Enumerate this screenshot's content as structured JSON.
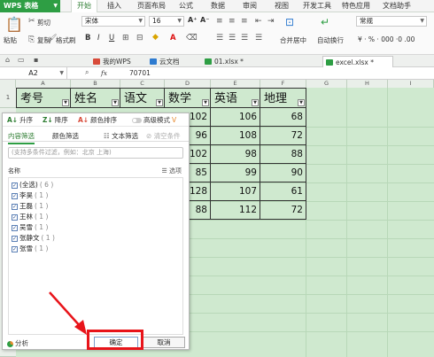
{
  "ribbon_tabs": {
    "app": "WPS 表格",
    "items": [
      "开始",
      "插入",
      "页面布局",
      "公式",
      "数据",
      "审阅",
      "视图",
      "开发工具",
      "特色应用",
      "文档助手"
    ],
    "active": "开始"
  },
  "ribbon": {
    "cut": "剪切",
    "paste": "粘贴",
    "copy": "复制",
    "format_painter": "格式刷",
    "font_name": "宋体",
    "font_size": "16",
    "merge_center": "合并居中",
    "wrap_text": "自动换行",
    "number_format": "常规",
    "number_buttons": "¥ · % · 000 ·0 .00"
  },
  "doc_tabs": [
    {
      "label": "我的WPS",
      "color": "#d84b3a"
    },
    {
      "label": "云文档",
      "color": "#2e7bd0"
    },
    {
      "label": "01.xlsx *",
      "color": "#2e9e44"
    },
    {
      "label": "excel.xlsx *",
      "color": "#2e9e44"
    }
  ],
  "formula_bar": {
    "cell_ref": "A2",
    "fx_icon": "fx",
    "value": "70701"
  },
  "grid": {
    "columns": [
      "A",
      "B",
      "C",
      "D",
      "E",
      "F",
      "G",
      "H",
      "I"
    ],
    "row_numbers": [
      "1"
    ],
    "headers": [
      "考号",
      "姓名",
      "语文",
      "数学",
      "英语",
      "地理"
    ],
    "rows": [
      {
        "math": "102",
        "english": "106",
        "geo": "68"
      },
      {
        "math": "96",
        "english": "108",
        "geo": "72"
      },
      {
        "math": "102",
        "english": "98",
        "geo": "88"
      },
      {
        "math": "85",
        "english": "99",
        "geo": "90"
      },
      {
        "math": "128",
        "english": "107",
        "geo": "61"
      },
      {
        "math": "88",
        "english": "112",
        "geo": "72"
      }
    ]
  },
  "filter_popup": {
    "sort_asc": "升序",
    "sort_desc": "降序",
    "sort_color": "颜色排序",
    "advanced_mode": "高级模式",
    "tab_content": "内容筛选",
    "tab_color": "颜色筛选",
    "text_filter": "文本筛选",
    "clear_condition": "清空条件",
    "search_placeholder": "(支持多条件过滤，例如：北京  上海)",
    "list_header": "名称",
    "options_label": "选项",
    "items": [
      {
        "label": "(全选)",
        "count": "( 6 )"
      },
      {
        "label": "李昊",
        "count": "( 1 )"
      },
      {
        "label": "王磊",
        "count": "( 1 )"
      },
      {
        "label": "王林",
        "count": "( 1 )"
      },
      {
        "label": "吴雪",
        "count": "( 1 )"
      },
      {
        "label": "张静文",
        "count": "( 1 )"
      },
      {
        "label": "张雪",
        "count": "( 1 )"
      }
    ],
    "analyze": "分析",
    "ok": "确定",
    "cancel": "取消"
  },
  "colors": {
    "brand_green": "#2e9e44",
    "sheet_fill": "#cfe9cf",
    "highlight_red": "#e8141a"
  }
}
